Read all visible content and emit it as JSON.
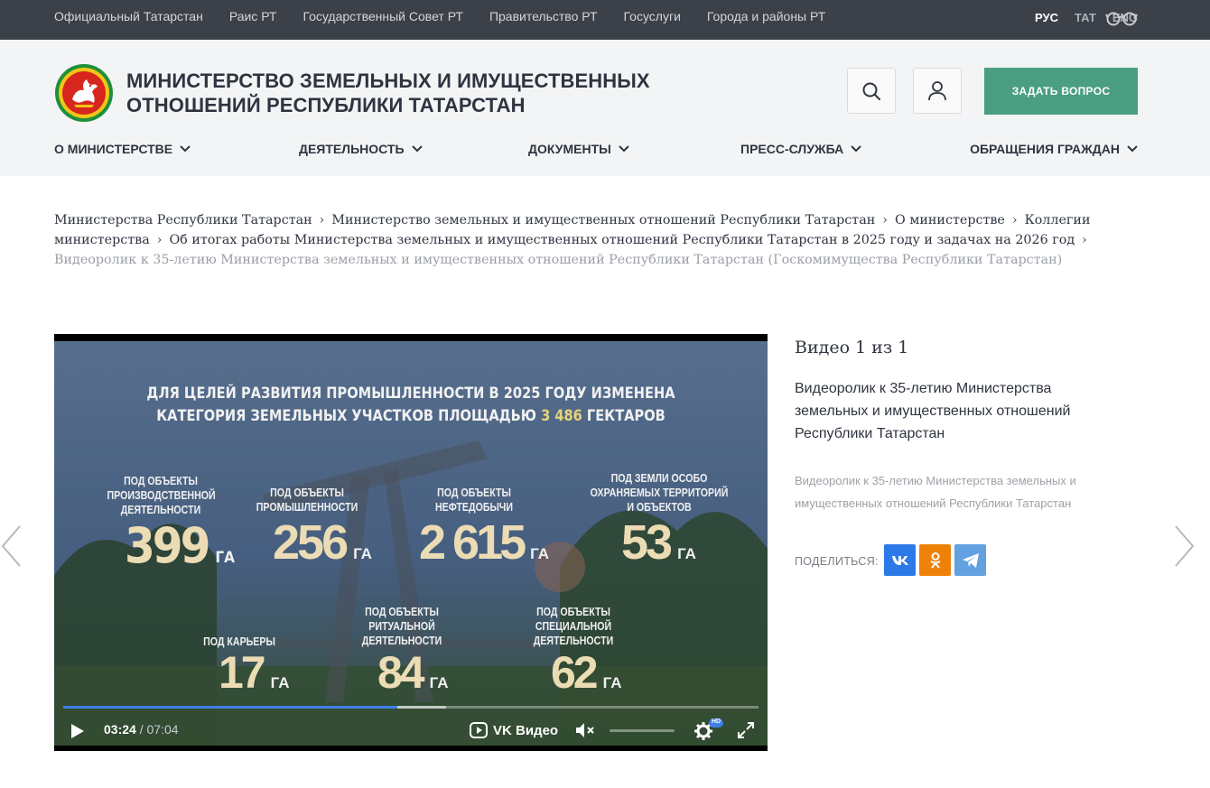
{
  "topbar": {
    "links": [
      "Официальный Татарстан",
      "Раис РТ",
      "Государственный Совет РТ",
      "Правительство РТ",
      "Госуслуги",
      "Города и районы РТ"
    ],
    "languages": [
      {
        "label": "РУС",
        "active": true
      },
      {
        "label": "ТАТ",
        "active": false
      },
      {
        "label": "ENG",
        "active": false
      }
    ],
    "accessibility_icon": "glasses-icon"
  },
  "header": {
    "title_line1": "МИНИСТЕРСТВО ЗЕМЕЛЬНЫХ И ИМУЩЕСТВЕННЫХ",
    "title_line2": "ОТНОШЕНИЙ РЕСПУБЛИКИ ТАТАРСТАН",
    "ask_button": "ЗАДАТЬ ВОПРОС",
    "accent_color": "#4a9e82"
  },
  "nav": [
    {
      "label": "О МИНИСТЕРСТВЕ"
    },
    {
      "label": "ДЕЯТЕЛЬНОСТЬ"
    },
    {
      "label": "ДОКУМЕНТЫ"
    },
    {
      "label": "ПРЕСС-СЛУЖБА"
    },
    {
      "label": "ОБРАЩЕНИЯ ГРАЖДАН"
    }
  ],
  "breadcrumbs": {
    "items": [
      "Министерства Республики Татарстан",
      "Министерство земельных и имущественных отношений Республики Татарстан",
      "О министерстве",
      "Коллегии министерства",
      "Об итогах работы Министерства земельных и имущественных отношений Республики Татарстан в 2025 году и задачах на 2026 год"
    ],
    "current": "Видеоролик к 35-летию Министерства земельных и имущественных отношений Республики Татарстан (Госкомимущества Республики Татарстан)"
  },
  "video": {
    "headline_line1": "ДЛЯ ЦЕЛЕЙ РАЗВИТИЯ ПРОМЫШЛЕННОСТИ В 2025 ГОДУ ИЗМЕНЕНА",
    "headline_line2_prefix": "КАТЕГОРИЯ ЗЕМЕЛЬНЫХ УЧАСТКОВ ПЛОЩАДЬЮ ",
    "headline_highlight": "3 486",
    "headline_line2_suffix": " ГЕКТАРОВ",
    "unit": "ГА",
    "stats": [
      {
        "label": [
          "ПОД ОБЪЕКТЫ",
          "ПРОИЗВОДСТВЕННОЙ",
          "ДЕЯТЕЛЬНОСТИ"
        ],
        "value": "399"
      },
      {
        "label": [
          "ПОД ОБЪЕКТЫ",
          "ПРОМЫШЛЕННОСТИ"
        ],
        "value": "256"
      },
      {
        "label": [
          "ПОД ОБЪЕКТЫ",
          "НЕФТЕДОБЫЧИ"
        ],
        "value": "2 615"
      },
      {
        "label": [
          "ПОД ЗЕМЛИ ОСОБО",
          "ОХРАНЯЕМЫХ ТЕРРИТОРИЙ",
          "И ОБЪЕКТОВ"
        ],
        "value": "53"
      },
      {
        "label": [
          "ПОД КАРЬЕРЫ"
        ],
        "value": "17"
      },
      {
        "label": [
          "ПОД ОБЪЕКТЫ",
          "РИТУАЛЬНОЙ",
          "ДЕЯТЕЛЬНОСТИ"
        ],
        "value": "84"
      },
      {
        "label": [
          "ПОД ОБЪЕКТЫ",
          "СПЕЦИАЛЬНОЙ",
          "ДЕЯТЕЛЬНОСТИ"
        ],
        "value": "62"
      }
    ],
    "current_time": "03:24",
    "duration": "07:04",
    "played_fraction": 0.48,
    "buffered_fraction": 0.55,
    "brand": "VK Видео",
    "quality_badge": "HD"
  },
  "info": {
    "counter": "Видео 1 из 1",
    "title": "Видеоролик к 35-летию Министерства земельных и имущественных отношений Республики Татарстан",
    "description": "Видеоролик к 35-летию Министерства земельных и имущественных отношений Республики Татарстан",
    "share_label": "ПОДЕЛИТЬСЯ:"
  }
}
